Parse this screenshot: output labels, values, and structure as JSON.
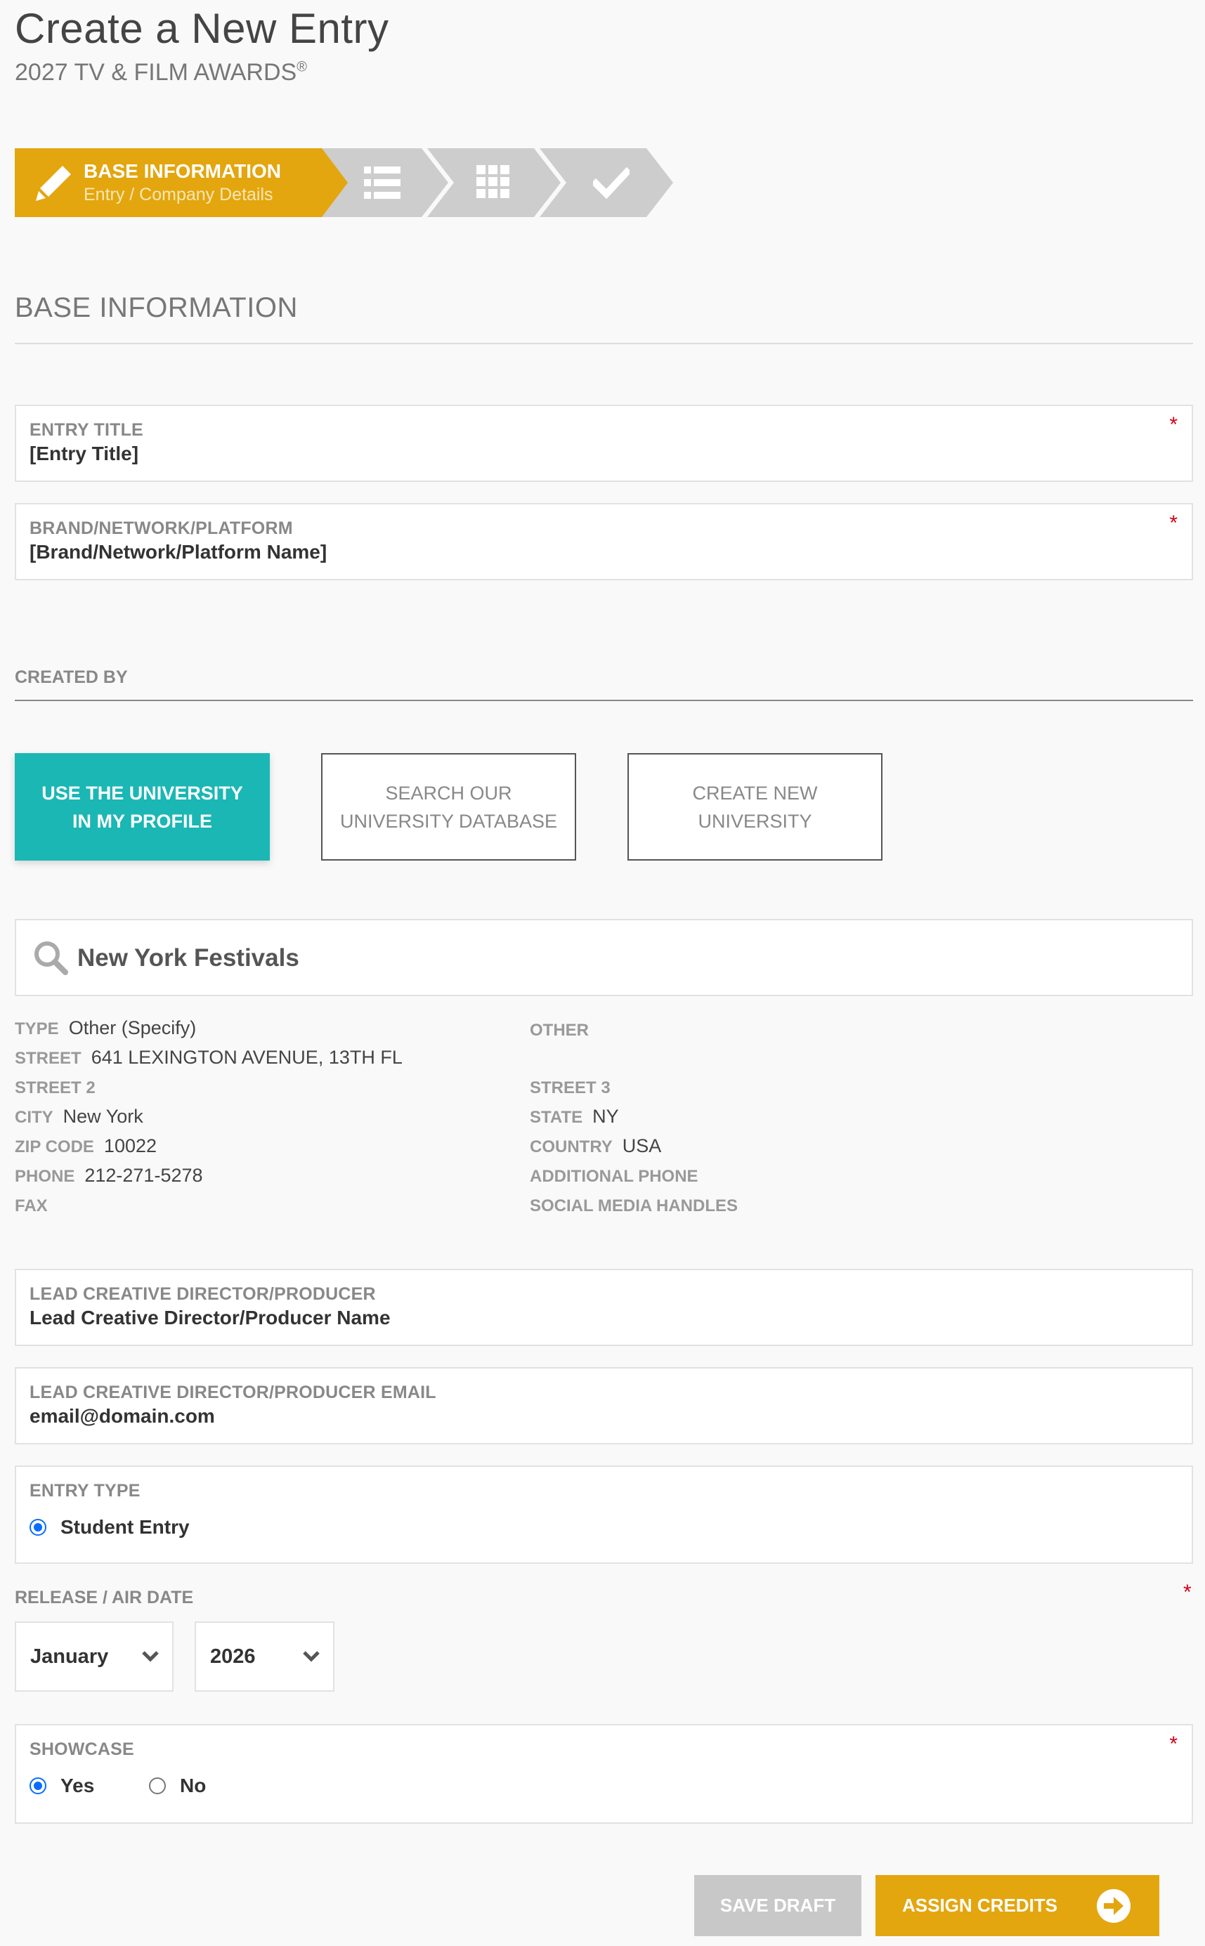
{
  "header": {
    "title": "Create a New Entry",
    "subtitle": "2027 TV & FILM AWARDS",
    "subtitle_mark": "®"
  },
  "stepper": {
    "active_label": "BASE INFORMATION",
    "active_sub": "Entry / Company Details",
    "steps": [
      {
        "icon": "list-icon"
      },
      {
        "icon": "grid-icon"
      },
      {
        "icon": "checkmark-icon"
      }
    ]
  },
  "section": {
    "title": "BASE INFORMATION"
  },
  "fields": {
    "entry_title": {
      "label": "ENTRY TITLE",
      "value": "[Entry Title]",
      "required": "*"
    },
    "brand": {
      "label": "BRAND/NETWORK/PLATFORM",
      "value": "[Brand/Network/Platform Name]",
      "required": "*"
    }
  },
  "created_by": {
    "label": "CREATED BY",
    "options": [
      {
        "line1": "USE THE UNIVERSITY",
        "line2": "IN MY PROFILE"
      },
      {
        "line1": "SEARCH OUR",
        "line2": "UNIVERSITY DATABASE"
      },
      {
        "line1": "CREATE NEW",
        "line2": "UNIVERSITY"
      }
    ],
    "search_value": "New York Festivals"
  },
  "organization": {
    "left": [
      {
        "k": "TYPE",
        "v": "Other (Specify)"
      },
      {
        "k": "STREET",
        "v": "641 LEXINGTON AVENUE, 13TH FL"
      },
      {
        "k": "STREET 2",
        "v": ""
      },
      {
        "k": "CITY",
        "v": "New York"
      },
      {
        "k": "ZIP CODE",
        "v": "10022"
      },
      {
        "k": "PHONE",
        "v": "212-271-5278"
      },
      {
        "k": "FAX",
        "v": ""
      }
    ],
    "right": [
      {
        "k": "OTHER",
        "v": ""
      },
      {
        "k": "STREET 3",
        "v": ""
      },
      {
        "k": "STATE",
        "v": "NY"
      },
      {
        "k": "COUNTRY",
        "v": "USA"
      },
      {
        "k": "ADDITIONAL PHONE",
        "v": ""
      },
      {
        "k": "SOCIAL MEDIA HANDLES",
        "v": ""
      }
    ]
  },
  "director": {
    "label": "LEAD CREATIVE DIRECTOR/PRODUCER",
    "value": "Lead Creative Director/Producer Name",
    "email_label": "LEAD CREATIVE DIRECTOR/PRODUCER EMAIL",
    "email_value": "email@domain.com"
  },
  "entry_type": {
    "label": "ENTRY TYPE",
    "option": "Student Entry"
  },
  "release": {
    "label": "RELEASE / AIR DATE",
    "required": "*",
    "month": "January",
    "year": "2026"
  },
  "showcase": {
    "label": "SHOWCASE",
    "required": "*",
    "yes": "Yes",
    "no": "No",
    "selected": "Yes"
  },
  "actions": {
    "save_label": "SAVE DRAFT",
    "assign_label": "ASSIGN CREDITS"
  },
  "colors": {
    "accent": "#e3a60f",
    "teal": "#1ab7b4",
    "required": "#d0021b",
    "radio": "#0a6cff"
  }
}
